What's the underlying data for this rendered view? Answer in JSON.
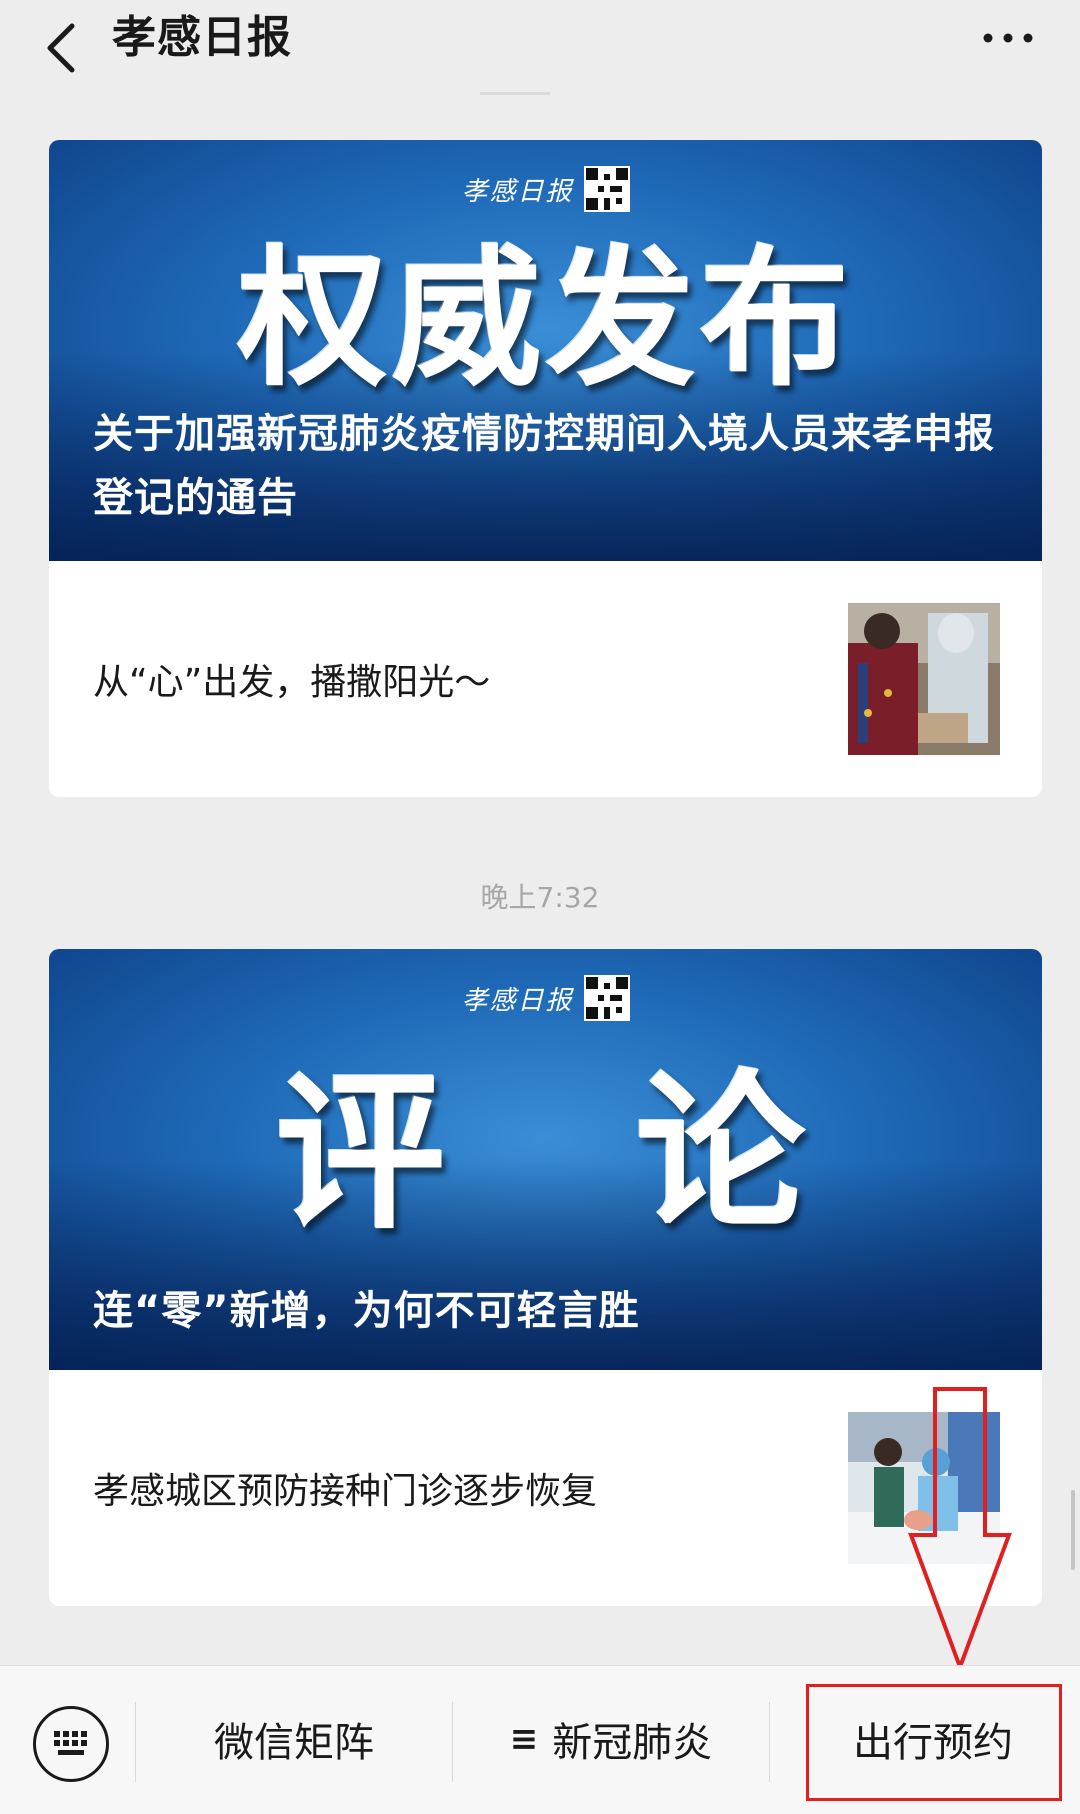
{
  "header": {
    "title": "孝感日报"
  },
  "articles": [
    {
      "brand": "孝感日报",
      "banner_title": "权威发布",
      "banner_caption": "关于加强新冠肺炎疫情防控期间入境人员来孝申报登记的通告",
      "sub_article_title": "从“心”出发，播撒阳光～"
    },
    {
      "brand": "孝感日报",
      "banner_title": "评　论",
      "banner_caption": "连“零”新增，为何不可轻言胜",
      "sub_article_title": "孝感城区预防接种门诊逐步恢复"
    }
  ],
  "timestamp": "晚上7:32",
  "footer_menu": {
    "items": [
      {
        "label": "微信矩阵",
        "icon": ""
      },
      {
        "label": "新冠肺炎",
        "icon": "≡"
      },
      {
        "label": "出行预约",
        "icon": ""
      }
    ]
  },
  "icons": {
    "back": "chevron-left-icon",
    "more": "more-dots-icon",
    "keyboard": "keyboard-icon"
  },
  "colors": {
    "background": "#ededed",
    "banner_blue": "#1f6ab8",
    "highlight_red": "#e0201e"
  }
}
